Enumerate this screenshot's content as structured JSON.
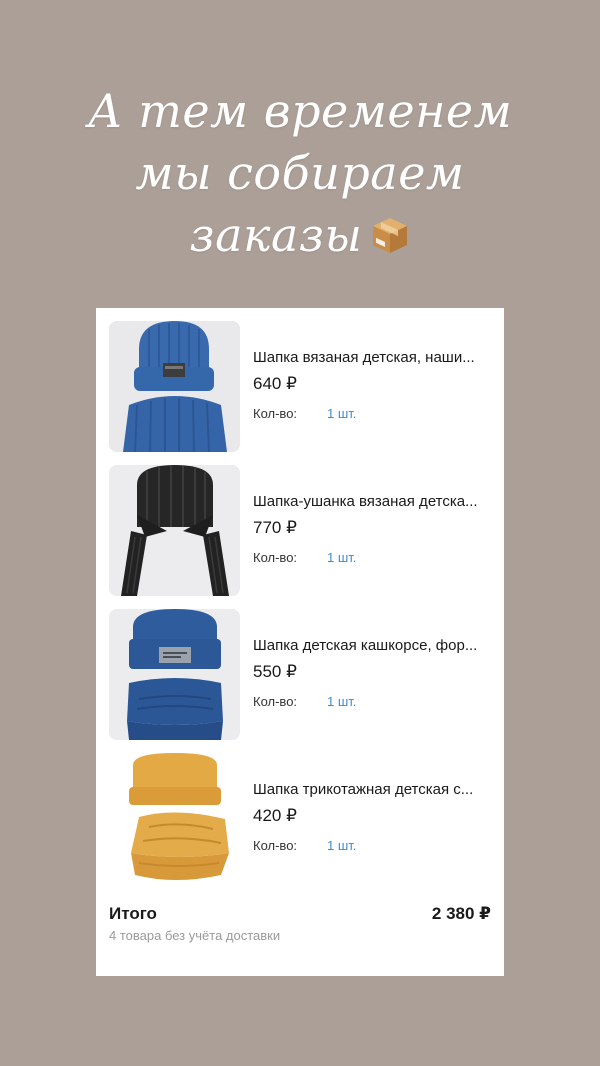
{
  "headline": {
    "line1": "А тем временем",
    "line2": "мы собираем",
    "line3": "заказы"
  },
  "cart": {
    "items": [
      {
        "title": "Шапка вязаная детская, наши...",
        "price": "640 ₽",
        "qty_label": "Кол-во:",
        "qty": "1 шт.",
        "thumb_icon": "blue-knit-hat-snood"
      },
      {
        "title": "Шапка-ушанка вязаная детска...",
        "price": "770 ₽",
        "qty_label": "Кол-во:",
        "qty": "1 шт.",
        "thumb_icon": "black-knit-earflap-hat"
      },
      {
        "title": "Шапка детская кашкорсе, фор...",
        "price": "550 ₽",
        "qty_label": "Кол-во:",
        "qty": "1 шт.",
        "thumb_icon": "blue-cotton-hat-snood"
      },
      {
        "title": "Шапка трикотажная детская с...",
        "price": "420 ₽",
        "qty_label": "Кол-во:",
        "qty": "1 шт.",
        "thumb_icon": "mustard-jersey-hat-snood"
      }
    ],
    "total_label": "Итого",
    "total_amount": "2 380 ₽",
    "total_note": "4 товара без учёта доставки"
  },
  "colors": {
    "background": "#ab9f97",
    "card": "#ffffff",
    "qty_accent": "#3a8fcc",
    "hat_blue": "#3566a8",
    "hat_black": "#222222",
    "hat_navy": "#2d5a9a",
    "hat_mustard": "#e0a744"
  }
}
